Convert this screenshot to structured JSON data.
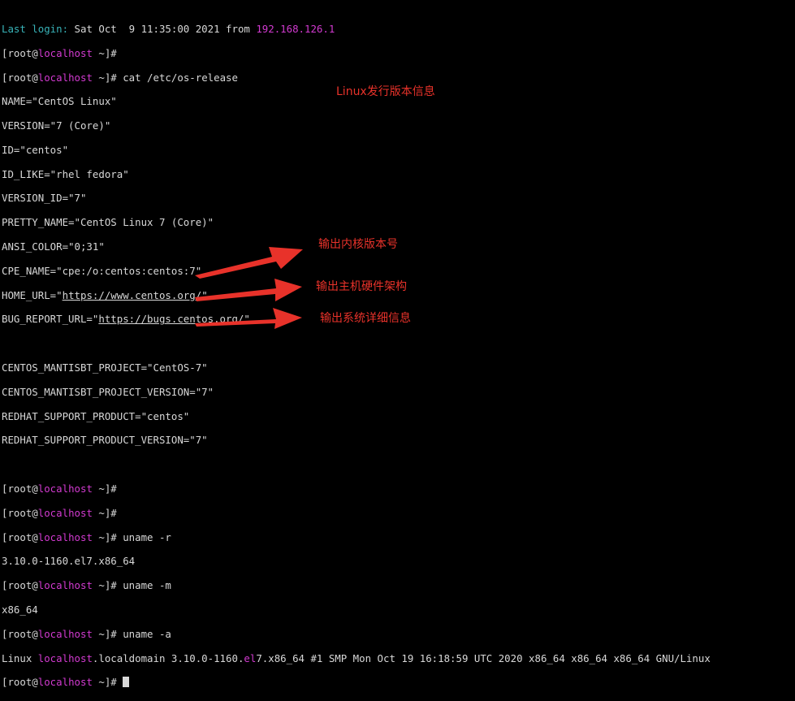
{
  "terminal": {
    "last_login_label": "Last login: ",
    "last_login_date": "Sat Oct  9 11:35:00 2021 from ",
    "last_login_ip": "192.168.126.1",
    "prompt_open": "[root@",
    "hostname": "localhost",
    "prompt_close": " ~]# ",
    "cmd_cat": "cat /etc/os-release",
    "os_release": {
      "name": "NAME=\"CentOS Linux\"",
      "version": "VERSION=\"7 (Core)\"",
      "id": "ID=\"centos\"",
      "id_like": "ID_LIKE=\"rhel fedora\"",
      "version_id": "VERSION_ID=\"7\"",
      "pretty_name": "PRETTY_NAME=\"CentOS Linux 7 (Core)\"",
      "ansi_color": "ANSI_COLOR=\"0;31\"",
      "cpe_name": "CPE_NAME=\"cpe:/o:centos:centos:7\"",
      "home_url_key": "HOME_URL=\"",
      "home_url": "https://www.centos.org/",
      "bug_url_key": "BUG_REPORT_URL=\"",
      "bug_url": "https://bugs.centos.org/",
      "quote": "\"",
      "mantis_project": "CENTOS_MANTISBT_PROJECT=\"CentOS-7\"",
      "mantis_version": "CENTOS_MANTISBT_PROJECT_VERSION=\"7\"",
      "redhat_product": "REDHAT_SUPPORT_PRODUCT=\"centos\"",
      "redhat_version": "REDHAT_SUPPORT_PRODUCT_VERSION=\"7\""
    },
    "cmd_uname_r": "uname -r",
    "out_uname_r": "3.10.0-1160.el7.x86_64",
    "cmd_uname_m": "uname -m",
    "out_uname_m": "x86_64",
    "cmd_uname_a": "uname -a",
    "out_uname_a_prefix": "Linux ",
    "out_uname_a_host": "localhost",
    "out_uname_a_mid": ".localdomain 3.10.0-1160.",
    "out_uname_a_el": "el",
    "out_uname_a_rest": "7.x86_64 #1 SMP Mon Oct 19 16:18:59 UTC 2020 x86_64 x86_64 x86_64 GNU/Linux"
  },
  "annotations": {
    "release_info": "Linux发行版本信息",
    "kernel_version": "输出内核版本号",
    "hardware_arch": "输出主机硬件架构",
    "system_detail": "输出系统详细信息"
  },
  "colors": {
    "background": "#000000",
    "text": "#d8d8d8",
    "hostname": "#d23ad0",
    "login_label": "#38b3b8",
    "annotation": "#e8322a"
  },
  "icons": {
    "arrow": "red-arrow-icon",
    "cursor": "block-cursor"
  }
}
